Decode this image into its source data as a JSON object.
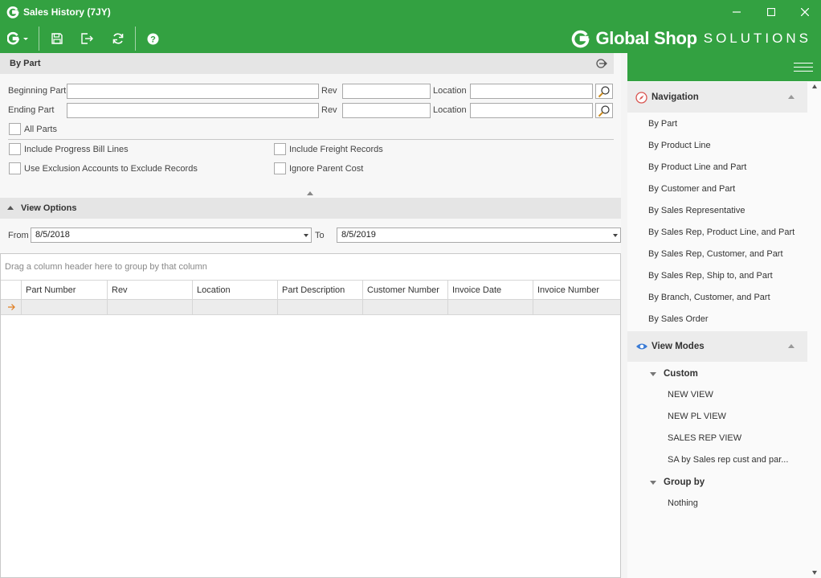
{
  "window": {
    "title": "Sales History (7JY)",
    "controls": [
      "minimize",
      "maximize",
      "close"
    ]
  },
  "toolbar": {
    "buttons": [
      "g-menu-icon",
      "save-icon",
      "exit-icon",
      "refresh-icon",
      "help-icon"
    ],
    "brand_name": "Global Shop",
    "brand_suffix": "SOLUTIONS"
  },
  "colors": {
    "accent": "#33a141",
    "panel_header": "#e5e5e5",
    "arrow": "#e07b1c"
  },
  "by_part": {
    "title": "By Part",
    "beginning_part_label": "Beginning Part",
    "ending_part_label": "Ending Part",
    "rev_label": "Rev",
    "location_label": "Location",
    "beginning_part_value": "",
    "ending_part_value": "",
    "all_parts_label": "All Parts",
    "include_progress_bill_lines_label": "Include Progress Bill Lines",
    "use_exclusion_accounts_label": "Use Exclusion Accounts to Exclude Records",
    "include_freight_records_label": "Include Freight Records",
    "ignore_parent_cost_label": "Ignore Parent Cost"
  },
  "view_options": {
    "title": "View Options",
    "from_label": "From",
    "from_value": "8/5/2018",
    "to_label": "To",
    "to_value": "8/5/2019"
  },
  "grid": {
    "group_panel_text": "Drag a column header here to group by that column",
    "columns": [
      "Part Number",
      "Rev",
      "Location",
      "Part Description",
      "Customer Number",
      "Invoice Date",
      "Invoice Number"
    ]
  },
  "navigation": {
    "title": "Navigation",
    "items": [
      "By Part",
      "By Product Line",
      "By Product Line and Part",
      "By Customer and Part",
      "By Sales Representative",
      "By Sales Rep, Product Line, and Part",
      "By Sales Rep, Customer, and Part",
      "By Sales Rep, Ship to, and Part",
      "By Branch, Customer, and Part",
      "By Sales Order"
    ]
  },
  "view_modes": {
    "title": "View Modes",
    "custom_label": "Custom",
    "custom_items": [
      "NEW VIEW",
      "NEW PL VIEW",
      "SALES REP VIEW",
      "SA by Sales rep cust and par..."
    ],
    "group_by_label": "Group by",
    "group_by_items": [
      "Nothing"
    ]
  }
}
